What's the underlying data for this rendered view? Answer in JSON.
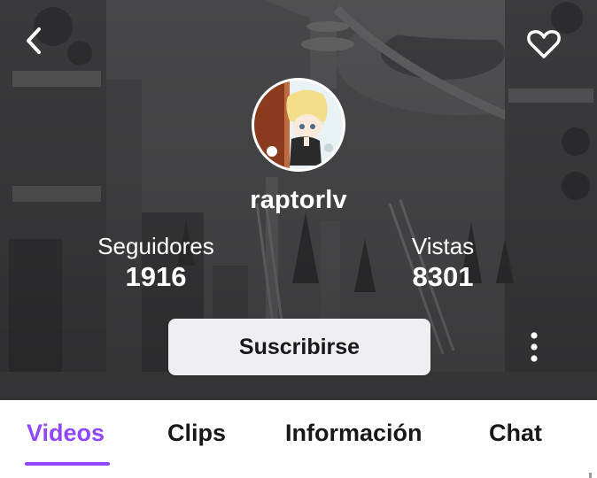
{
  "channel": {
    "username": "raptorlv",
    "avatar_description": "anime-style avatar",
    "followers_label": "Seguidores",
    "followers_count": "1916",
    "views_label": "Vistas",
    "views_count": "8301"
  },
  "actions": {
    "subscribe_label": "Suscribirse"
  },
  "icons": {
    "back": "chevron-left-icon",
    "favorite": "heart-outline-icon",
    "more": "vertical-dots-icon"
  },
  "tabs": [
    {
      "label": "Videos",
      "active": true
    },
    {
      "label": "Clips",
      "active": false
    },
    {
      "label": "Información",
      "active": false
    },
    {
      "label": "Chat",
      "active": false
    }
  ],
  "colors": {
    "accent": "#9147ff",
    "banner": "#4a4a4c",
    "button_bg": "#efeff1",
    "text_dark": "#18181b"
  }
}
